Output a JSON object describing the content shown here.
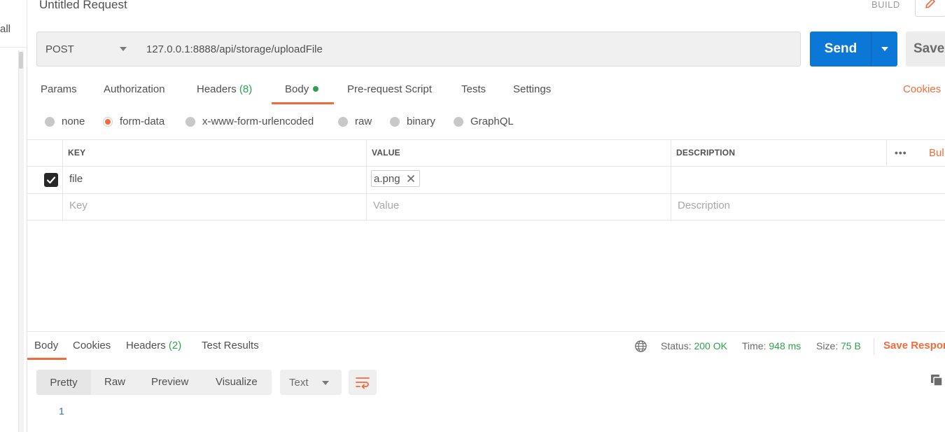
{
  "sidebar": {
    "fragment_label": "all"
  },
  "header": {
    "title": "Untitled Request",
    "mode_label": "BUILD",
    "edit_icon": "pencil-icon"
  },
  "request": {
    "method": "POST",
    "url": "127.0.0.1:8888/api/storage/uploadFile",
    "send_label": "Send",
    "save_label": "Save"
  },
  "request_tabs": {
    "params": "Params",
    "authorization": "Authorization",
    "headers": "Headers",
    "headers_count": "(8)",
    "body": "Body",
    "prerequest": "Pre-request Script",
    "tests": "Tests",
    "settings": "Settings",
    "active": "Body",
    "cookies": "Cookies"
  },
  "body_types": {
    "none": "none",
    "form_data": "form-data",
    "urlencoded": "x-www-form-urlencoded",
    "raw": "raw",
    "binary": "binary",
    "graphql": "GraphQL",
    "selected": "form-data"
  },
  "params_table": {
    "headers": {
      "key": "KEY",
      "value": "VALUE",
      "description": "DESCRIPTION"
    },
    "more_icon": "ellipsis-icon",
    "bulk_edit_fragment": "Bul",
    "rows": [
      {
        "checked": true,
        "key": "file",
        "value_file": "a.png",
        "description": ""
      }
    ],
    "placeholders": {
      "key": "Key",
      "value": "Value",
      "description": "Description"
    }
  },
  "response": {
    "tabs": {
      "body": "Body",
      "cookies": "Cookies",
      "headers": "Headers",
      "headers_count": "(2)",
      "test_results": "Test Results"
    },
    "status_label": "Status:",
    "status_value": "200 OK",
    "time_label": "Time:",
    "time_value": "948 ms",
    "size_label": "Size:",
    "size_value": "75 B",
    "save_response_fragment": "Save Respor",
    "view_modes": {
      "pretty": "Pretty",
      "raw": "Raw",
      "preview": "Preview",
      "visualize": "Visualize"
    },
    "format": "Text",
    "line_number": "1"
  },
  "colors": {
    "accent": "#f26b3a",
    "primary": "#0b77d6",
    "success": "#2ca24c"
  }
}
